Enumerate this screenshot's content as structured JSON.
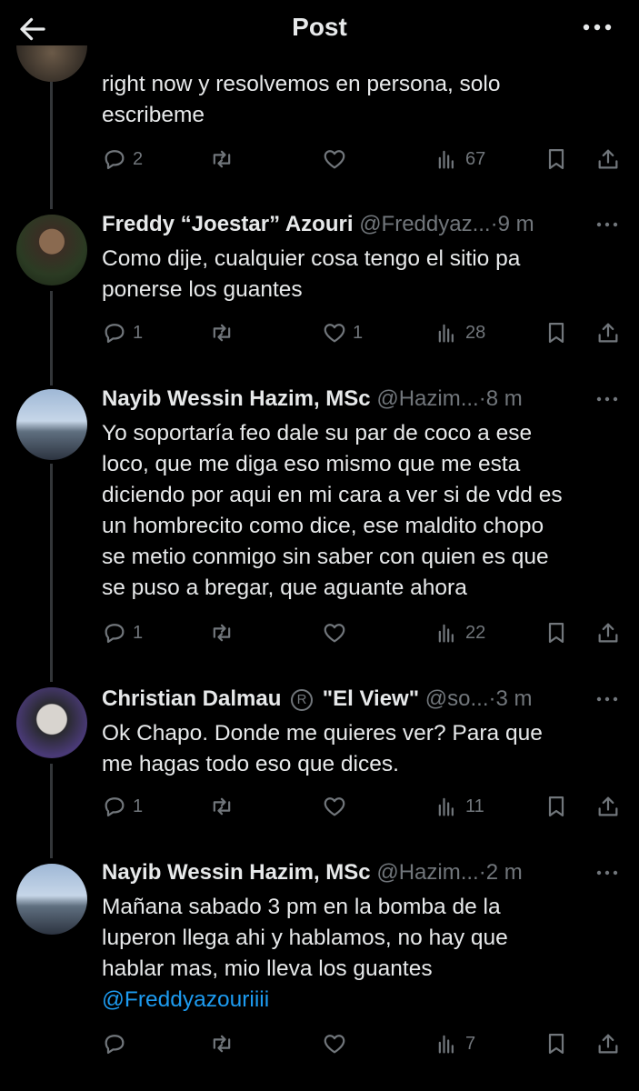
{
  "header": {
    "title": "Post",
    "back_icon": "arrow-left-icon",
    "more_icon": "more-horizontal-icon"
  },
  "colors": {
    "background": "#000000",
    "text": "#e7e9ea",
    "muted": "#71767b",
    "link": "#1d9bf0"
  },
  "tweets": [
    {
      "name": "",
      "handle": "",
      "time": "",
      "text_lines": [
        "right now y resolvemos en persona, solo",
        "escribeme"
      ],
      "mention": "",
      "replies": "2",
      "retweets": "",
      "likes": "",
      "views": "67"
    },
    {
      "name": "Freddy “Joestar” Azouri",
      "handle": "@Freddyaz...",
      "time": "9 m",
      "text_lines": [
        "Como dije, cualquier cosa tengo el sitio pa",
        "ponerse los guantes"
      ],
      "mention": "",
      "replies": "1",
      "retweets": "",
      "likes": "1",
      "views": "28"
    },
    {
      "name": "Nayib Wessin Hazim, MSc",
      "handle": "@Hazim...",
      "time": "8 m",
      "text_lines": [
        "Yo soportaría feo dale su par de coco a ese",
        "loco, que me diga eso mismo que me esta",
        "diciendo por aqui en mi cara a ver si de vdd es",
        "un hombrecito como dice, ese maldito chopo",
        "se metio conmigo sin saber con quien es que",
        "se puso a bregar, que aguante ahora"
      ],
      "mention": "",
      "replies": "1",
      "retweets": "",
      "likes": "",
      "views": "22"
    },
    {
      "name": "Christian Dalmau",
      "name_badge": "R",
      "name_suffix": "\"El View\"",
      "handle": "@so...",
      "time": "3 m",
      "text_lines": [
        "Ok Chapo. Donde me quieres ver? Para que",
        "me hagas todo eso que dices."
      ],
      "mention": "",
      "replies": "1",
      "retweets": "",
      "likes": "",
      "views": "11"
    },
    {
      "name": "Nayib Wessin Hazim, MSc",
      "handle": "@Hazim...",
      "time": "2 m",
      "text_lines": [
        "Mañana sabado 3 pm en la bomba de la",
        "luperon llega ahi y hablamos, no hay que",
        "hablar mas, mio lleva los guantes"
      ],
      "mention": "@Freddyazouriiii",
      "replies": "",
      "retweets": "",
      "likes": "",
      "views": "7"
    }
  ]
}
